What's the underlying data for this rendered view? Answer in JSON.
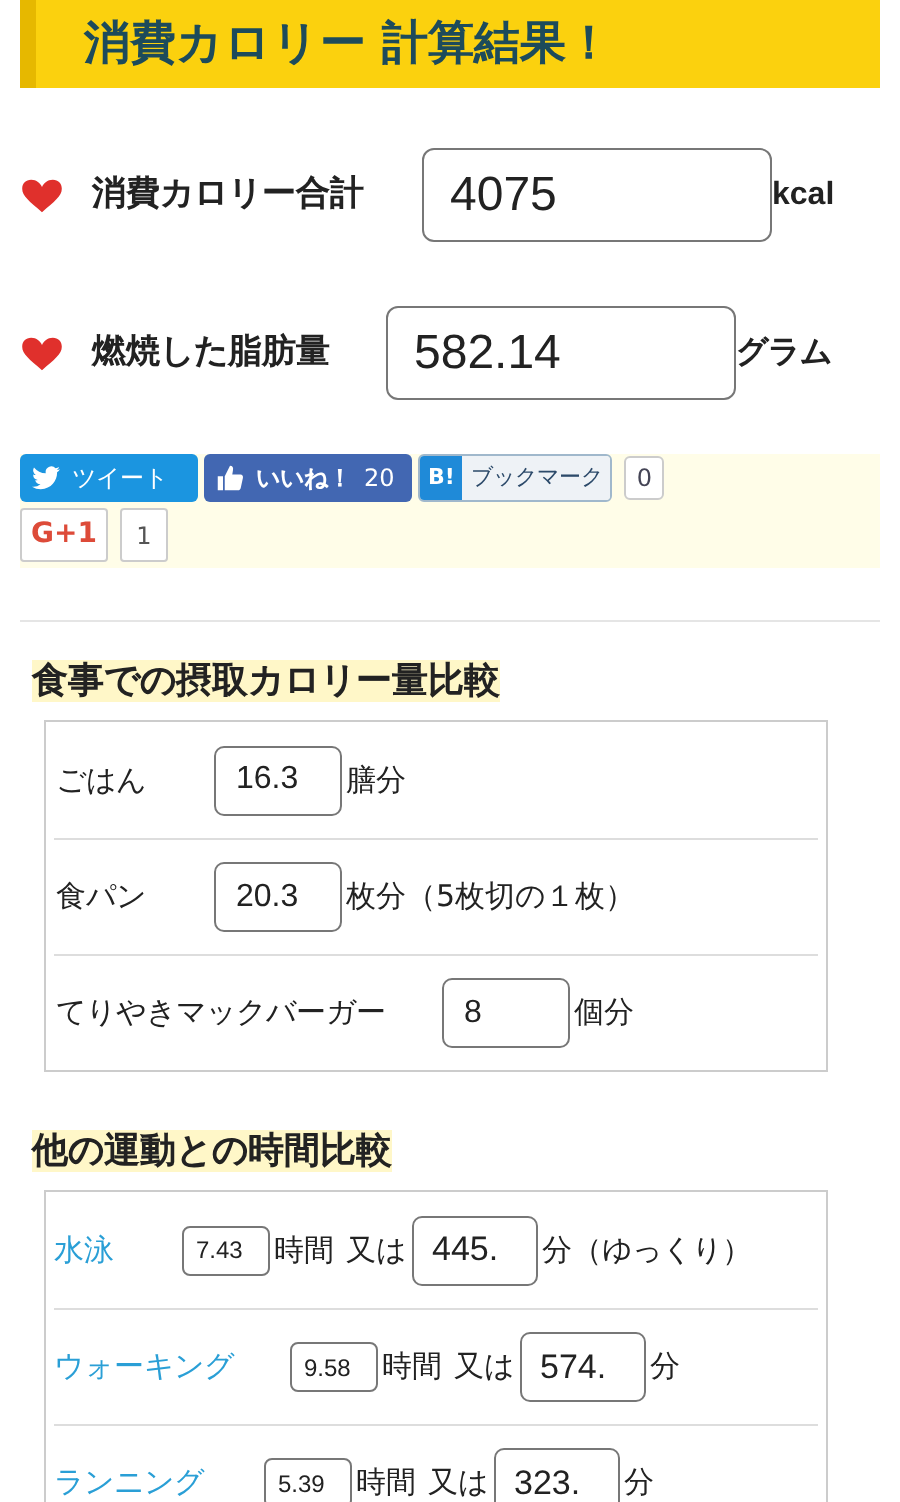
{
  "header": {
    "title": "消費カロリー 計算結果！"
  },
  "results": [
    {
      "label": "消費カロリー合計",
      "value": "4075",
      "unit": "kcal"
    },
    {
      "label": "燃焼した脂肪量",
      "value": "582.14",
      "unit": "グラム"
    }
  ],
  "social": {
    "tweet": "ツイート",
    "like": "いいね！",
    "like_count": "20",
    "bookmark_badge": "B!",
    "bookmark": "ブックマーク",
    "bookmark_count": "0",
    "gplus": "G+1",
    "gplus_count": "1"
  },
  "food": {
    "heading": "食事での摂取カロリー量比較",
    "rows": [
      {
        "label": "ごはん",
        "value": "16.3",
        "unit": "膳分"
      },
      {
        "label": "食パン",
        "value": "20.3",
        "unit": "枚分（5枚切の１枚）"
      },
      {
        "label": "てりやきマックバーガー",
        "value": "8",
        "unit": "個分"
      }
    ]
  },
  "exercise": {
    "heading": "他の運動との時間比較",
    "rows": [
      {
        "label": "水泳",
        "hours": "7.43",
        "hours_unit": "時間",
        "or": "又は",
        "minutes": "445.",
        "minutes_unit": "分（ゆっくり）"
      },
      {
        "label": "ウォーキング",
        "hours": "9.58",
        "hours_unit": "時間",
        "or": "又は",
        "minutes": "574.",
        "minutes_unit": "分"
      },
      {
        "label": "ランニング",
        "hours": "5.39",
        "hours_unit": "時間",
        "or": "又は",
        "minutes": "323.",
        "minutes_unit": "分"
      }
    ]
  }
}
